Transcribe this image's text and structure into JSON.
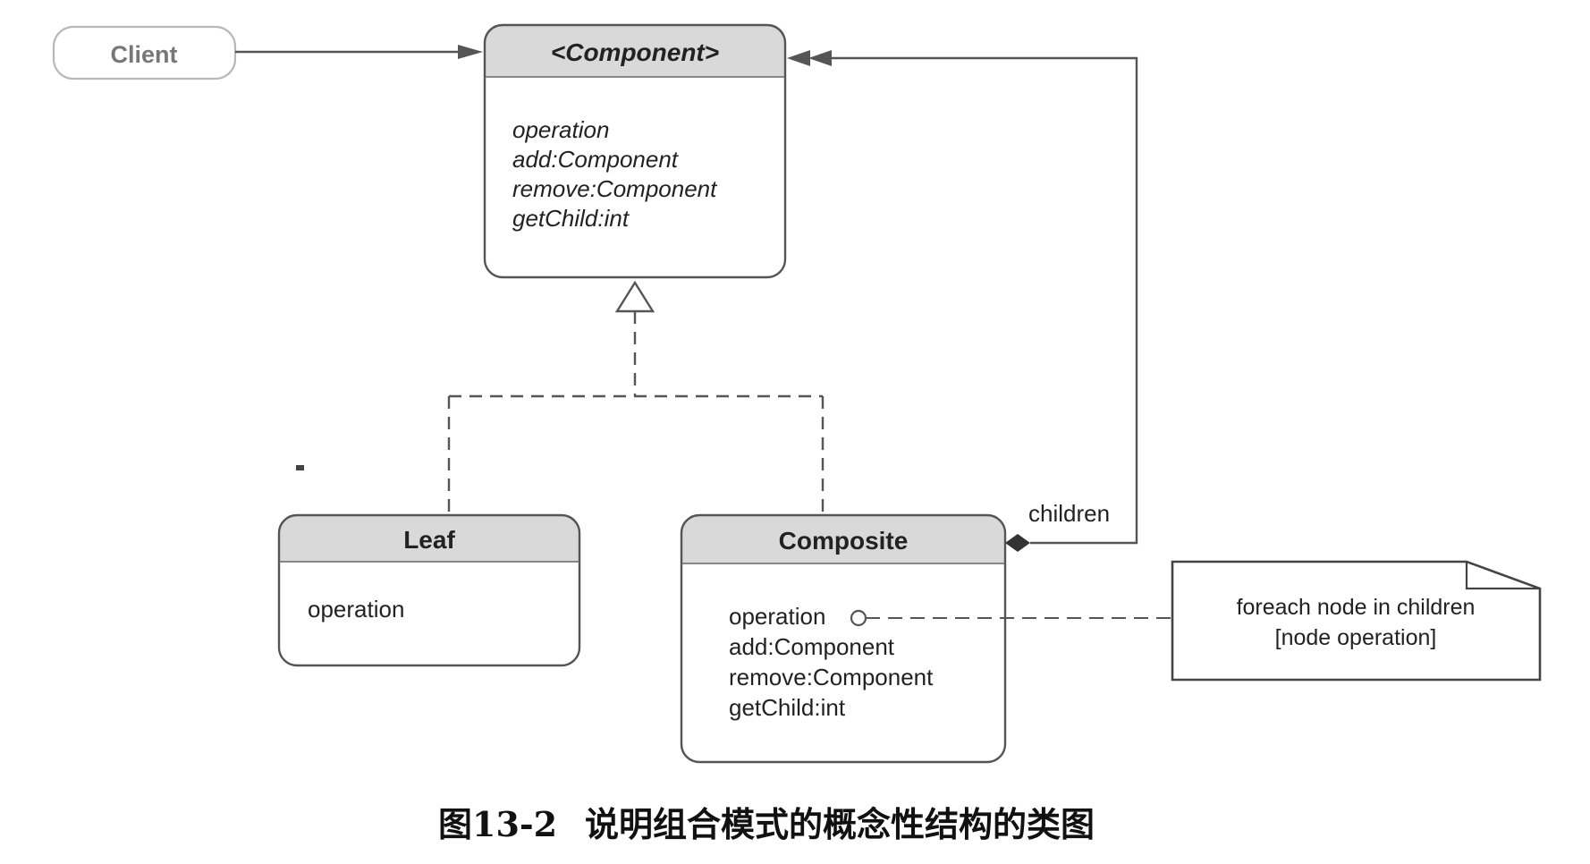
{
  "client": {
    "label": "Client"
  },
  "component": {
    "title": "<Component>",
    "operations": [
      "operation",
      "add:Component",
      "remove:Component",
      "getChild:int"
    ]
  },
  "leaf": {
    "title": "Leaf",
    "operations": [
      "operation"
    ]
  },
  "composite": {
    "title": "Composite",
    "operations": [
      "operation",
      "add:Component",
      "remove:Component",
      "getChild:int"
    ]
  },
  "association": {
    "role": "children"
  },
  "note": {
    "lines": [
      "foreach node in children",
      "[node operation]"
    ]
  },
  "caption": {
    "number": "图13-2",
    "text": "说明组合模式的概念性结构的类图"
  }
}
